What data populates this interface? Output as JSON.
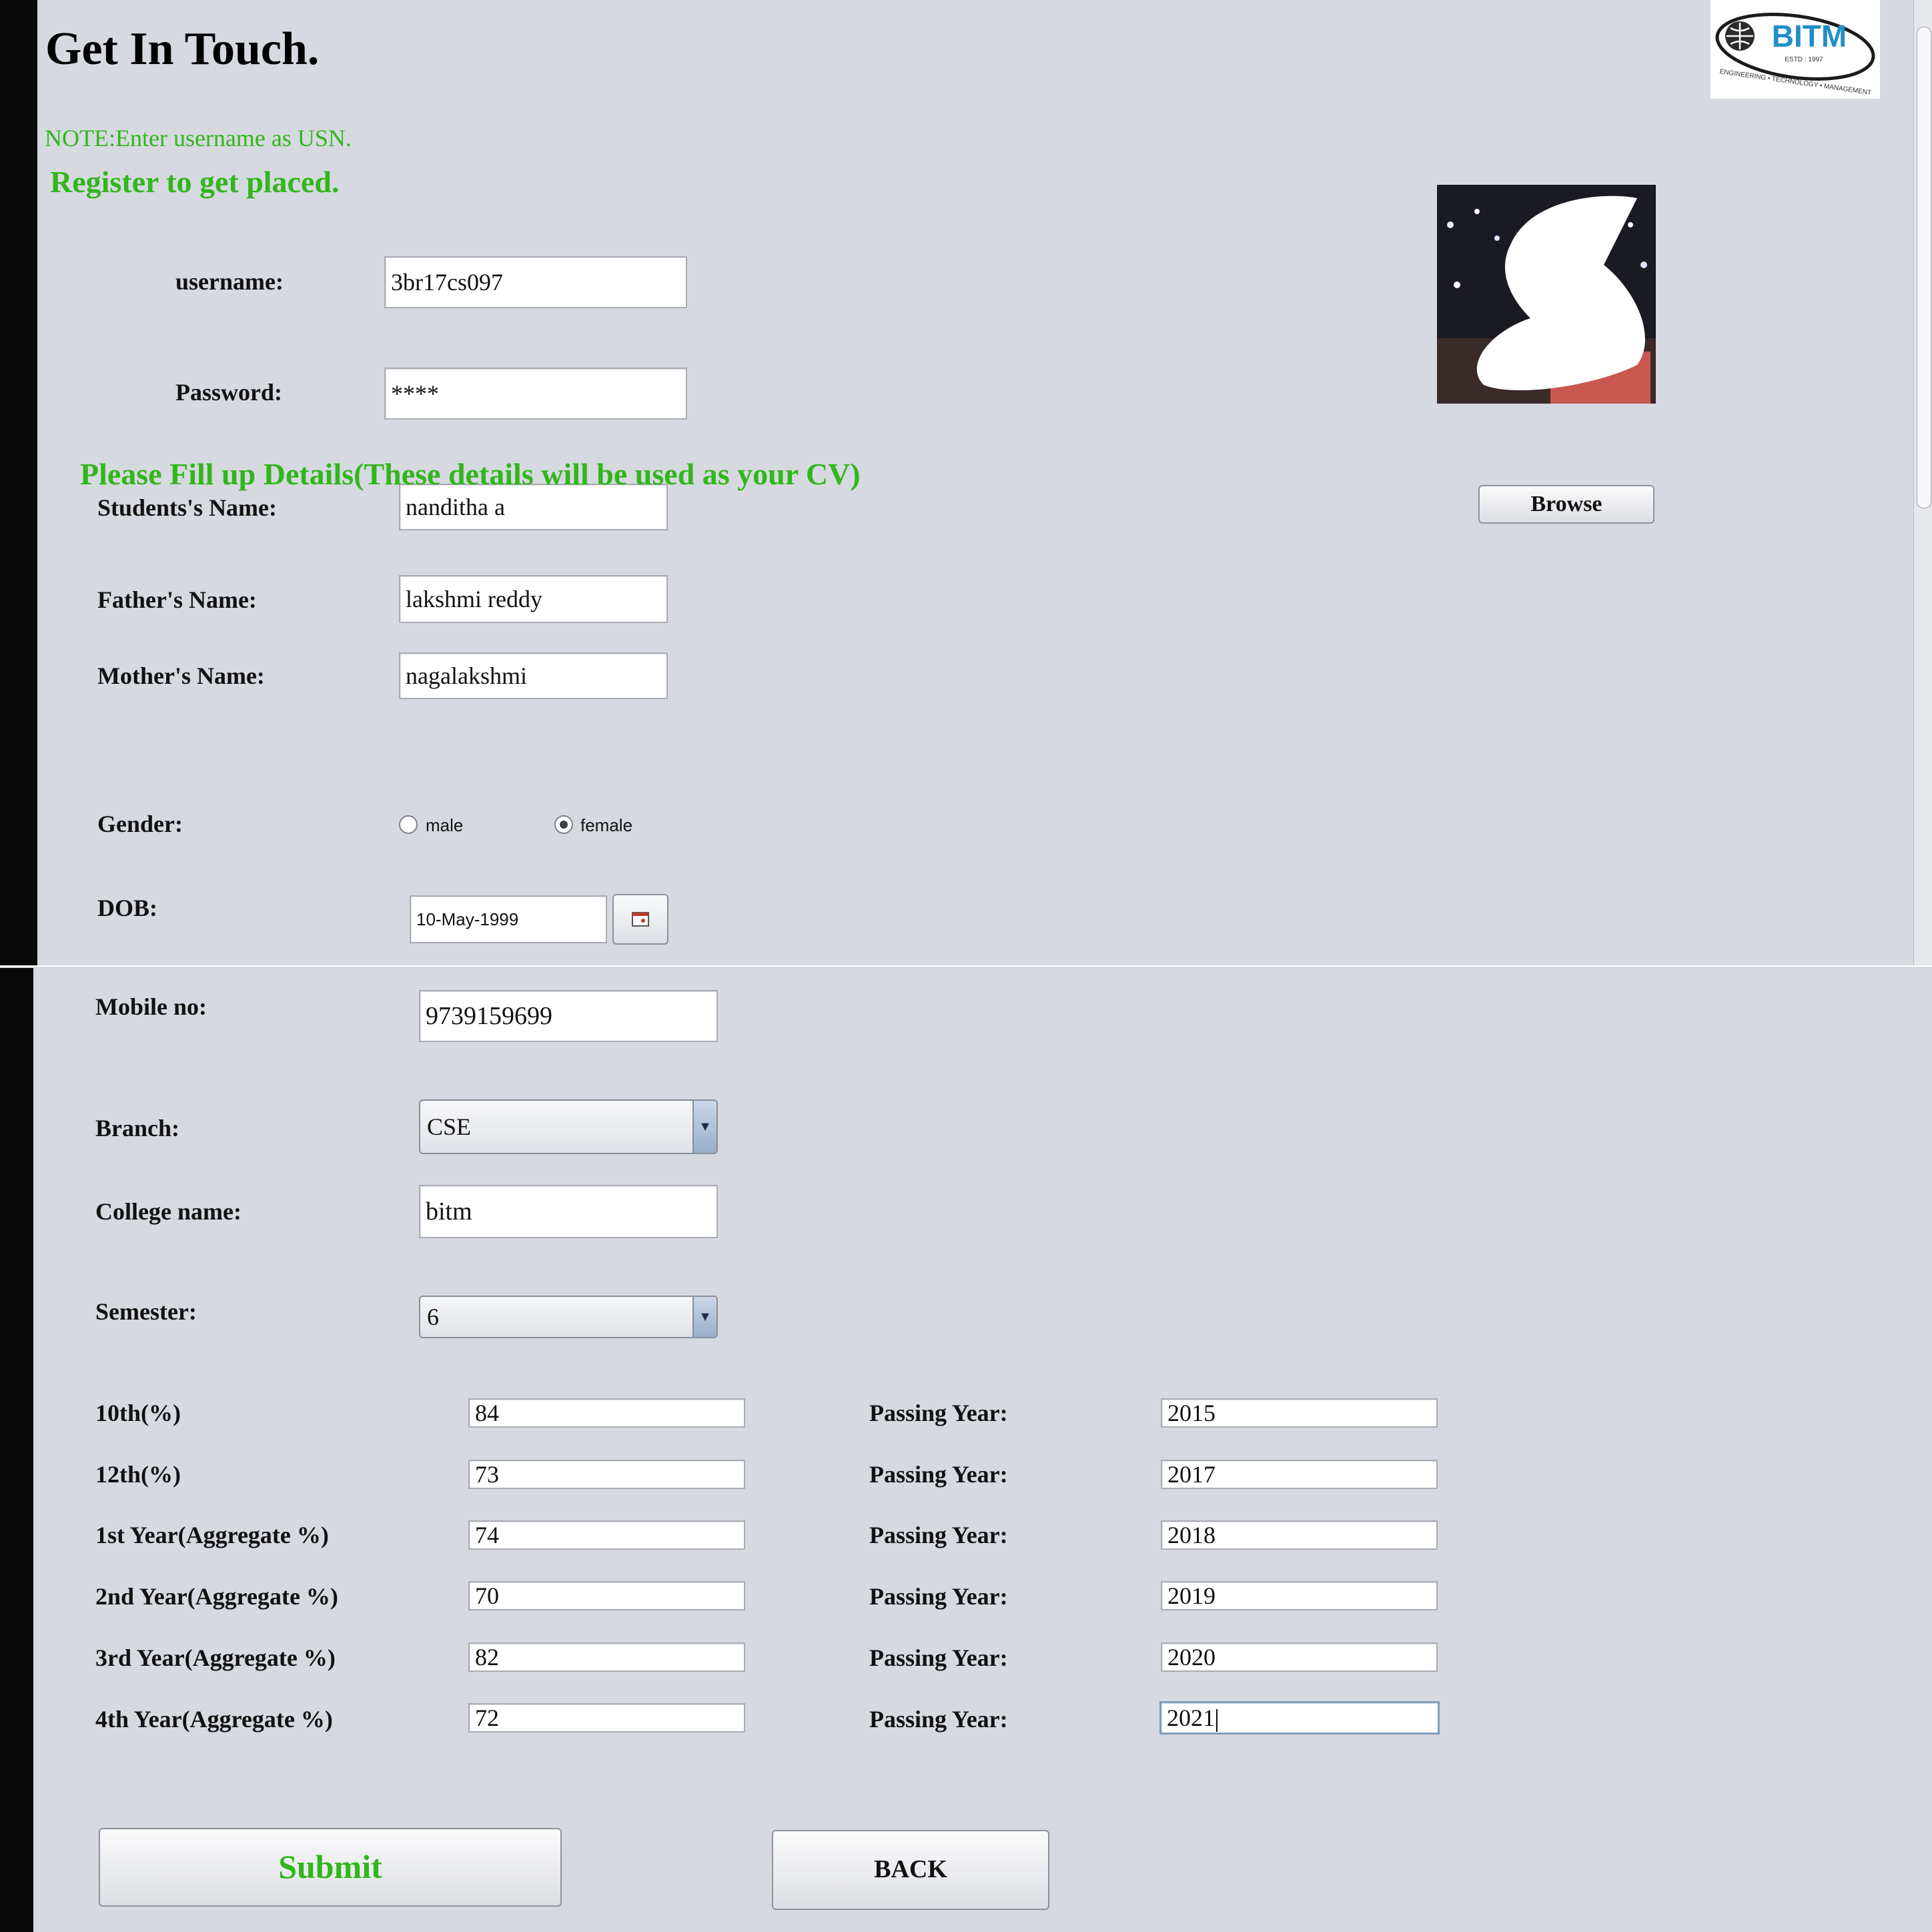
{
  "header": {
    "title": "Get In Touch.",
    "note": "NOTE:Enter username as USN.",
    "register": "Register to get placed.",
    "details_heading": "Please Fill up Details(These details will be used as your CV)"
  },
  "logo": {
    "text": "BITM",
    "estd": "ESTD : 1997",
    "tagline": "ENGINEERING • TECHNOLOGY • MANAGEMENT"
  },
  "account": {
    "username_label": "username:",
    "username_value": "3br17cs097",
    "password_label": "Password:",
    "password_value": "****"
  },
  "photo": {
    "browse_label": "Browse"
  },
  "personal": {
    "student_label": "Students's Name:",
    "student_value": "nanditha a",
    "father_label": "Father's Name:",
    "father_value": "lakshmi reddy",
    "mother_label": "Mother's Name:",
    "mother_value": "nagalakshmi",
    "gender_label": "Gender:",
    "gender_options": [
      "male",
      "female"
    ],
    "gender_selected": "female",
    "dob_label": "DOB:",
    "dob_value": "10-May-1999",
    "mobile_label": "Mobile no:",
    "mobile_value": "9739159699",
    "branch_label": "Branch:",
    "branch_value": "CSE",
    "college_label": "College name:",
    "college_value": "bitm",
    "semester_label": "Semester:",
    "semester_value": "6"
  },
  "academics": [
    {
      "label": "10th(%)",
      "percent": "84",
      "year_label": "Passing Year:",
      "year": "2015"
    },
    {
      "label": "12th(%)",
      "percent": "73",
      "year_label": "Passing Year:",
      "year": "2017"
    },
    {
      "label": "1st Year(Aggregate %)",
      "percent": "74",
      "year_label": "Passing Year:",
      "year": "2018"
    },
    {
      "label": "2nd Year(Aggregate %)",
      "percent": "70",
      "year_label": "Passing Year:",
      "year": "2019"
    },
    {
      "label": "3rd Year(Aggregate %)",
      "percent": "82",
      "year_label": "Passing Year:",
      "year": "2020"
    },
    {
      "label": "4th Year(Aggregate %)",
      "percent": "72",
      "year_label": "Passing Year:",
      "year": "2021"
    }
  ],
  "actions": {
    "submit_label": "Submit",
    "back_label": "BACK"
  },
  "colors": {
    "accent_green": "#31b61b",
    "background": "#d6d9e0",
    "logo_blue": "#1f8fc9"
  }
}
